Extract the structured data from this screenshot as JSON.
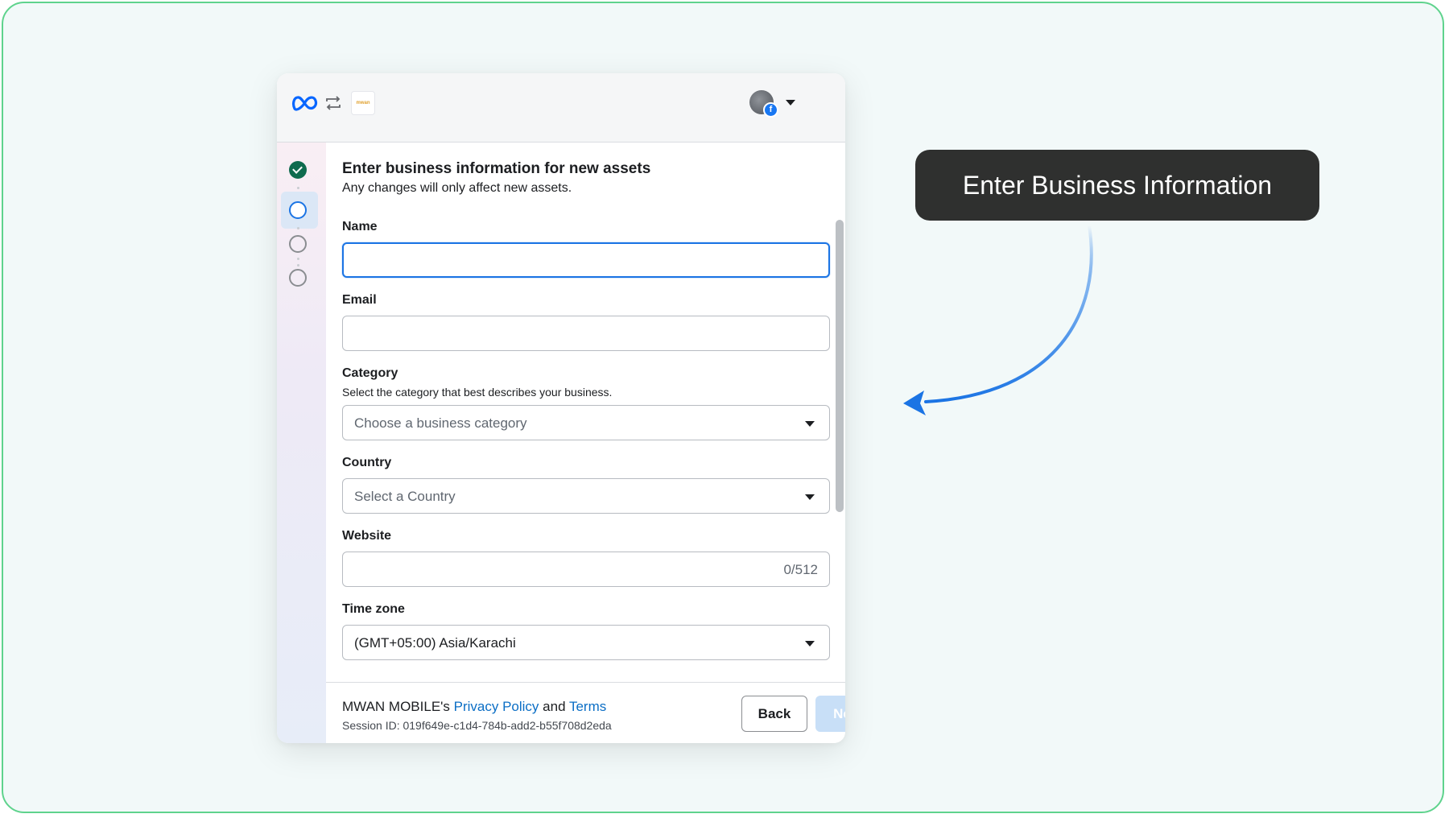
{
  "header": {
    "logo_icon": "meta-logo-icon",
    "swap_icon": "swap-arrows-icon",
    "partner_logo_text": "mwan",
    "avatar_icon": "profile-avatar",
    "badge_icon": "facebook-badge-icon",
    "badge_text": "f"
  },
  "steps": [
    {
      "state": "completed"
    },
    {
      "state": "active"
    },
    {
      "state": "todo"
    },
    {
      "state": "todo"
    }
  ],
  "form": {
    "title": "Enter business information for new assets",
    "subtitle": "Any changes will only affect new assets.",
    "name_label": "Name",
    "name_value": "",
    "email_label": "Email",
    "email_value": "",
    "category_label": "Category",
    "category_help": "Select the category that best describes your business.",
    "category_placeholder": "Choose a business category",
    "country_label": "Country",
    "country_placeholder": "Select a Country",
    "website_label": "Website",
    "website_counter": "0/512",
    "timezone_label": "Time zone",
    "timezone_value": "(GMT+05:00) Asia/Karachi"
  },
  "footer": {
    "legal_prefix": "MWAN MOBILE's ",
    "privacy_link": "Privacy Policy",
    "legal_and": " and ",
    "terms_link": "Terms",
    "session": "Session ID: 019f649e-c1d4-784b-add2-b55f708d2eda",
    "back_label": "Back",
    "next_label": "Next"
  },
  "annotation": {
    "callout_text": "Enter Business Information"
  },
  "colors": {
    "accent": "#1b74e4",
    "frame_border": "#5fd38d",
    "step_done": "#0f6b4e",
    "callout_bg": "#2f302f",
    "link": "#0b6ec5",
    "next_disabled": "#c8dff7"
  }
}
